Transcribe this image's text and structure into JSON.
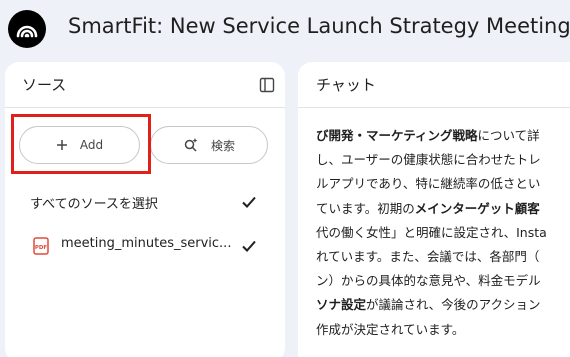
{
  "app": {
    "title": "SmartFit: New Service Launch Strategy Meeting"
  },
  "sources_panel": {
    "title": "ソース",
    "add_label": "Add",
    "search_label": "検索",
    "select_all_label": "すべてのソースを選択",
    "items": [
      {
        "name": "meeting_minutes_servic..."
      }
    ]
  },
  "chat_panel": {
    "title": "チャット",
    "lines": [
      {
        "b1": "び開発・マーケティング戦略",
        "t1": "について詳"
      },
      {
        "t1": "し、ユーザーの健康状態に合わせたトレ"
      },
      {
        "t1": "ルアプリであり、特に継続率の低さとい"
      },
      {
        "t1": "ています。初期の",
        "b1": "メインターゲット顧客"
      },
      {
        "t1": "代の働く女性」と明確に設定され、Insta"
      },
      {
        "t1": "れています。また、会議では、各部門（"
      },
      {
        "t1": "ン）からの具体的な意見や、料金モデル"
      },
      {
        "b1": "ソナ設定",
        "t1": "が議論され、今後のアクション"
      },
      {
        "t1": "作成が決定されています。"
      }
    ]
  },
  "colors": {
    "background": "#eef1f8",
    "panel": "#ffffff",
    "highlight": "#e0201b",
    "pdf_red": "#e24a3b"
  }
}
